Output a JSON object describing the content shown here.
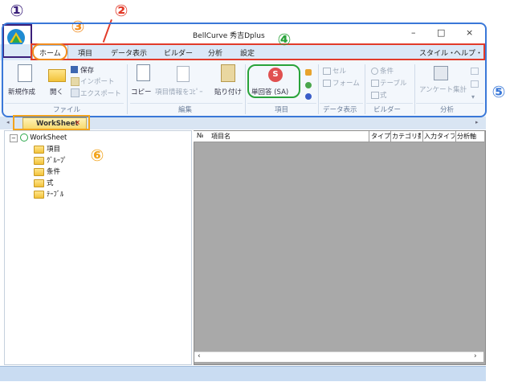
{
  "window": {
    "title": "BellCurve 秀吉Dplus",
    "controls": [
      "–",
      "□",
      "×"
    ]
  },
  "tabs": [
    {
      "label": "ホーム"
    },
    {
      "label": "項目"
    },
    {
      "label": "データ表示"
    },
    {
      "label": "ビルダー"
    },
    {
      "label": "分析"
    },
    {
      "label": "設定"
    }
  ],
  "tabs_right": {
    "style": "スタイル・",
    "help": "ヘルプ・"
  },
  "ribbon": {
    "file": {
      "group": "ファイル",
      "new": "新規作成",
      "open": "開く",
      "save": "保存",
      "import": "インポート",
      "export": "エクスポート"
    },
    "edit": {
      "group": "編集",
      "copy": "コピー",
      "copy_info": "項目情報をｺﾋﾟｰ",
      "paste": "貼り付け"
    },
    "item": {
      "group": "項目",
      "single": "単回答 (SA)"
    },
    "display": {
      "group": "データ表示",
      "cell": "セル",
      "form": "フォーム"
    },
    "builder": {
      "group": "ビルダー",
      "condition": "条件",
      "table": "テーブル",
      "formula": "式"
    },
    "analysis": {
      "group": "分析",
      "survey": "アンケート集計"
    }
  },
  "doc_tab": {
    "label": "WorkSheet",
    "close": "×"
  },
  "tree": {
    "root": "WorkSheet",
    "children": [
      "項目",
      "ｸﾞﾙｰﾌﾟ",
      "条件",
      "式",
      "ﾃｰﾌﾞﾙ"
    ]
  },
  "grid": {
    "columns": [
      "№",
      "項目名",
      "タイプ",
      "カテゴリ数",
      "入力タイプ",
      "分析軸"
    ]
  },
  "annotations": {
    "n1": "①",
    "n2": "②",
    "n3": "③",
    "n4": "④",
    "n5": "⑤",
    "n6": "⑥",
    "colors": {
      "purple": "#3a1f7a",
      "red": "#e23b2a",
      "orange": "#f28c1e",
      "green": "#29a33a",
      "blue": "#3a78d8",
      "amber": "#f2a41e"
    }
  }
}
